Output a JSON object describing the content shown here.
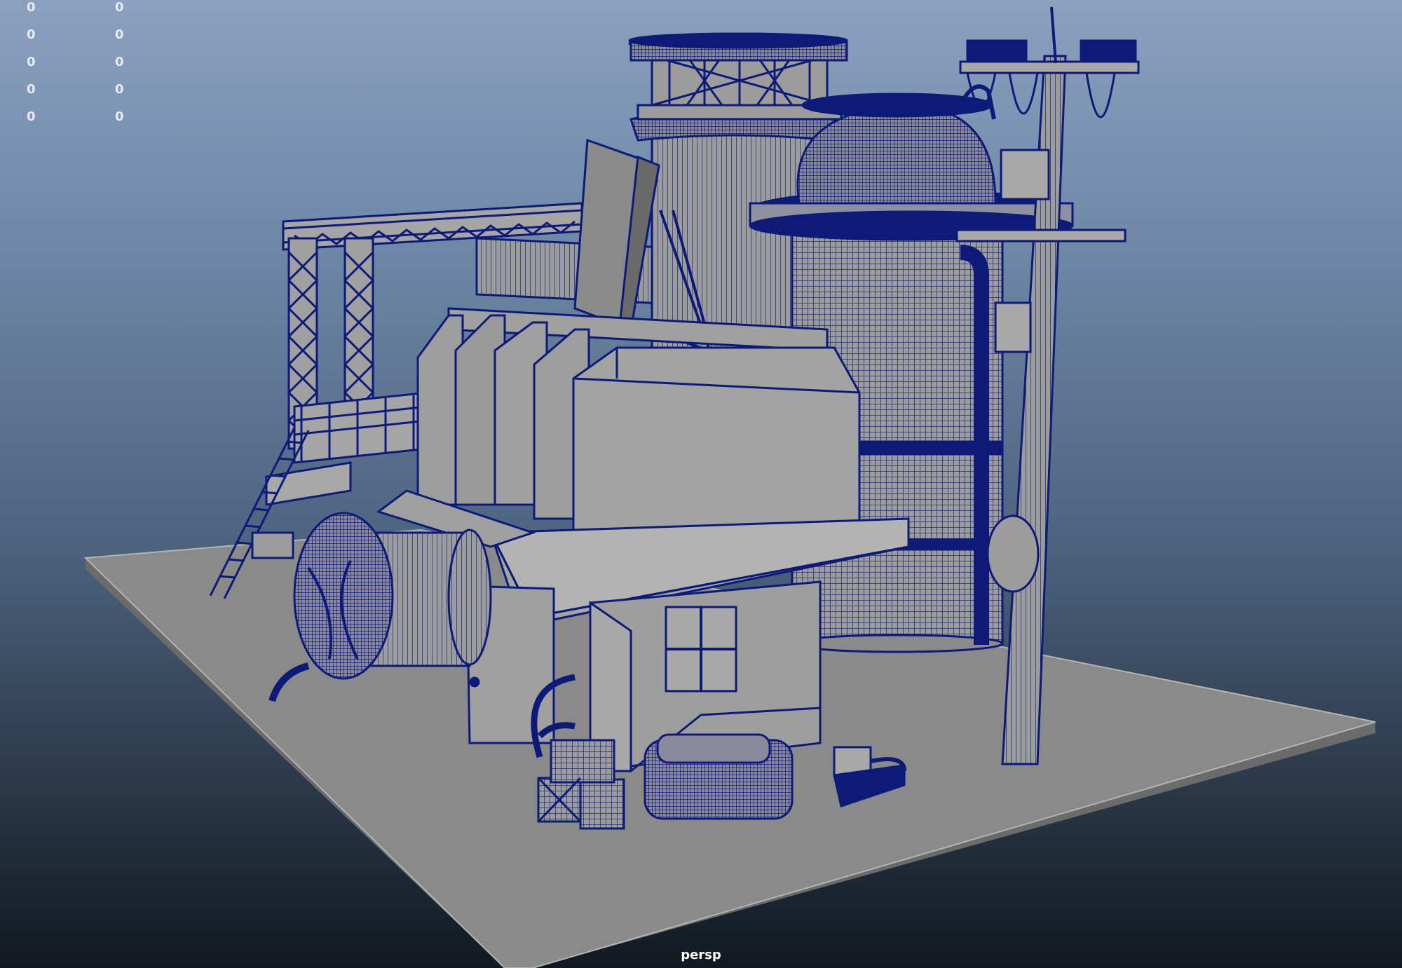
{
  "viewport": {
    "camera_label": "persp"
  },
  "hud": {
    "rows": [
      {
        "a": "0",
        "b": "0"
      },
      {
        "a": "0",
        "b": "0"
      },
      {
        "a": "0",
        "b": "0"
      },
      {
        "a": "0",
        "b": "0"
      },
      {
        "a": "0",
        "b": "0"
      }
    ]
  },
  "colors": {
    "wire": "#0d1a78",
    "surface": "#9c9c9c",
    "surface_dark": "#7a7a7a",
    "floor": "#8a8a8a",
    "floor_edge": "#b6b6b6"
  }
}
